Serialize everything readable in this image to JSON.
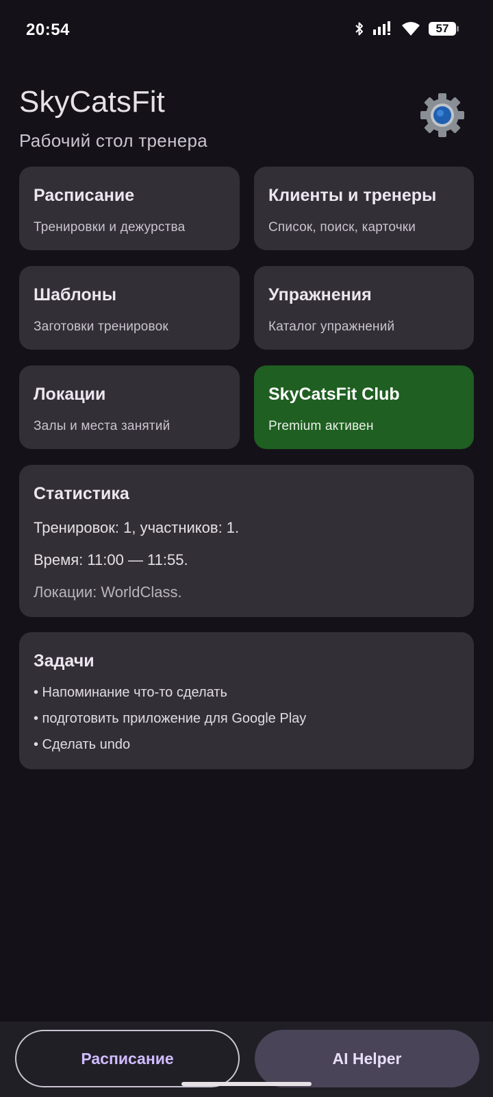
{
  "status_bar": {
    "time": "20:54",
    "battery": "57",
    "icons": [
      "bluetooth-icon",
      "signal-icon",
      "wifi-icon",
      "battery-icon"
    ]
  },
  "header": {
    "title": "SkyCatsFit",
    "subtitle": "Рабочий стол тренера",
    "settings_icon": "gear-icon"
  },
  "tiles": [
    {
      "title": "Расписание",
      "subtitle": "Тренировки и дежурства"
    },
    {
      "title": "Клиенты и тренеры",
      "subtitle": "Список, поиск, карточки"
    },
    {
      "title": "Шаблоны",
      "subtitle": "Заготовки тренировок"
    },
    {
      "title": "Упражнения",
      "subtitle": "Каталог упражнений"
    },
    {
      "title": "Локации",
      "subtitle": "Залы и места занятий"
    },
    {
      "title": "SkyCatsFit Club",
      "subtitle": "Premium активен"
    }
  ],
  "stats": {
    "title": "Статистика",
    "lines": [
      "Тренировок: 1, участников: 1.",
      "Время: 11:00 — 11:55.",
      "Локации: WorldClass."
    ]
  },
  "tasks": {
    "title": "Задачи",
    "items": [
      "• Напоминание что-то сделать",
      "• подготовить приложение для Google Play",
      "• Сделать undo"
    ]
  },
  "bottom": {
    "schedule_label": "Расписание",
    "ai_label": "AI Helper"
  },
  "colors": {
    "background": "#141218",
    "card": "#323036",
    "club_card": "#1f5f22",
    "accent": "#d0bcff"
  }
}
